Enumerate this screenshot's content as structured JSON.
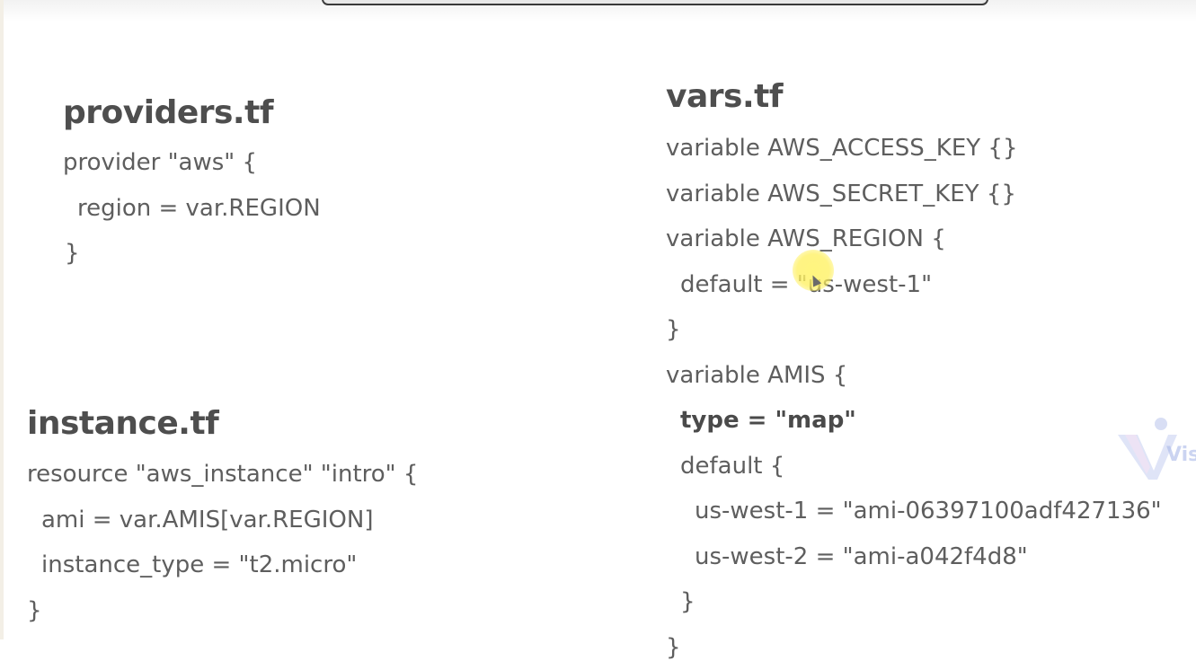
{
  "providers": {
    "title": "providers.tf",
    "lines": [
      "provider \"aws\" {",
      "region = var.REGION",
      "}"
    ]
  },
  "instance": {
    "title": "instance.tf",
    "lines": [
      "resource \"aws_instance\" \"intro\" {",
      "ami = var.AMIS[var.REGION]",
      "instance_type = \"t2.micro\"",
      "}"
    ]
  },
  "vars": {
    "title": "vars.tf",
    "lines": [
      "variable AWS_ACCESS_KEY {}",
      "variable AWS_SECRET_KEY {}",
      "variable AWS_REGION {",
      "default = \"us-west-1\"",
      "}",
      "variable AMIS {",
      "type = \"map\"",
      "default {",
      "us-west-1 = \"ami-06397100adf427136\"",
      "us-west-2 = \"ami-a042f4d8\"",
      "}",
      "}"
    ]
  },
  "watermark": {
    "text": "Vis"
  },
  "colors": {
    "heading": "#4e4e4e",
    "text": "#5e5e5e",
    "cursor_highlight": "#fff078",
    "watermark": "#a9b8e8"
  }
}
